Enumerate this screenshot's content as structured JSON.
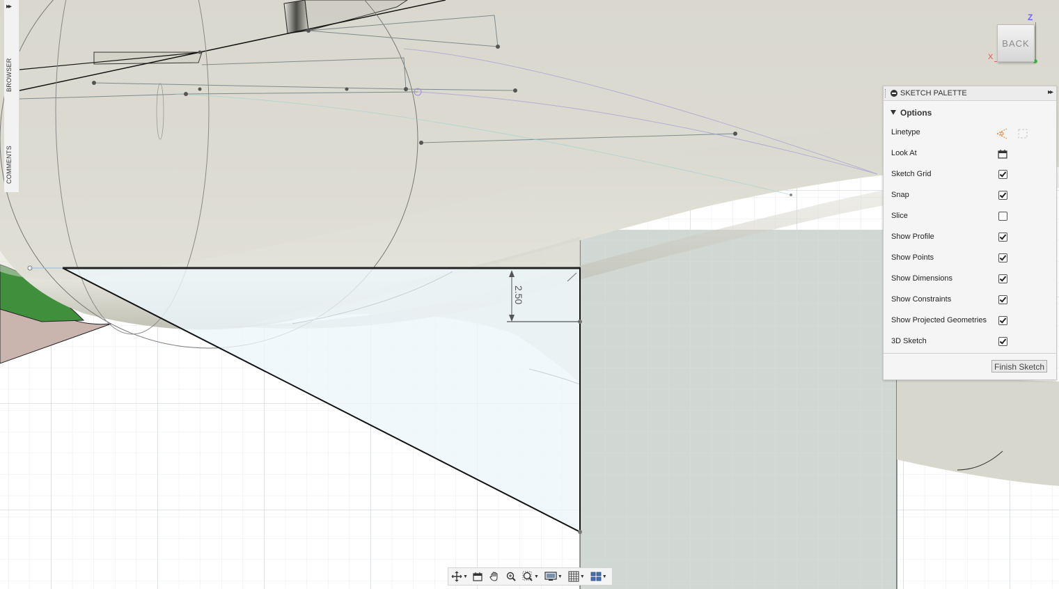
{
  "sidebar": {
    "expand_glyph": "▸▸",
    "tabs": [
      {
        "label": "BROWSER"
      },
      {
        "label": "COMMENTS"
      }
    ]
  },
  "viewcube": {
    "face_label": "BACK",
    "axis_z": "Z",
    "axis_x": "X"
  },
  "sketch": {
    "dimension_label": "2.50"
  },
  "palette": {
    "title": "SKETCH PALETTE",
    "collapse_glyph": "▸▸",
    "section": "Options",
    "rows": [
      {
        "label": "Linetype",
        "type": "icons",
        "icons": [
          "construction-linetype-icon",
          "centerline-linetype-icon"
        ]
      },
      {
        "label": "Look At",
        "type": "icon",
        "icons": [
          "look-at-icon"
        ]
      },
      {
        "label": "Sketch Grid",
        "type": "checkbox",
        "checked": true
      },
      {
        "label": "Snap",
        "type": "checkbox",
        "checked": true
      },
      {
        "label": "Slice",
        "type": "checkbox",
        "checked": false
      },
      {
        "label": "Show Profile",
        "type": "checkbox",
        "checked": true
      },
      {
        "label": "Show Points",
        "type": "checkbox",
        "checked": true
      },
      {
        "label": "Show Dimensions",
        "type": "checkbox",
        "checked": true
      },
      {
        "label": "Show Constraints",
        "type": "checkbox",
        "checked": true
      },
      {
        "label": "Show Projected Geometries",
        "type": "checkbox",
        "checked": true
      },
      {
        "label": "3D Sketch",
        "type": "checkbox",
        "checked": true
      }
    ],
    "finish_label": "Finish Sketch"
  },
  "navbar": {
    "tools": [
      "orbit-icon",
      "look-at-icon",
      "pan-icon",
      "zoom-icon",
      "zoom-window-icon",
      "display-settings-icon",
      "grid-settings-icon",
      "viewports-icon"
    ]
  },
  "colors": {
    "body_light": "#dddcd2",
    "body_shade": "#c9c8bd",
    "sketch_profile": "#eef6fb",
    "plane": "#cfd5d0",
    "green_part": "#3f8f3c",
    "palette_bg": "#f5f5f5"
  }
}
